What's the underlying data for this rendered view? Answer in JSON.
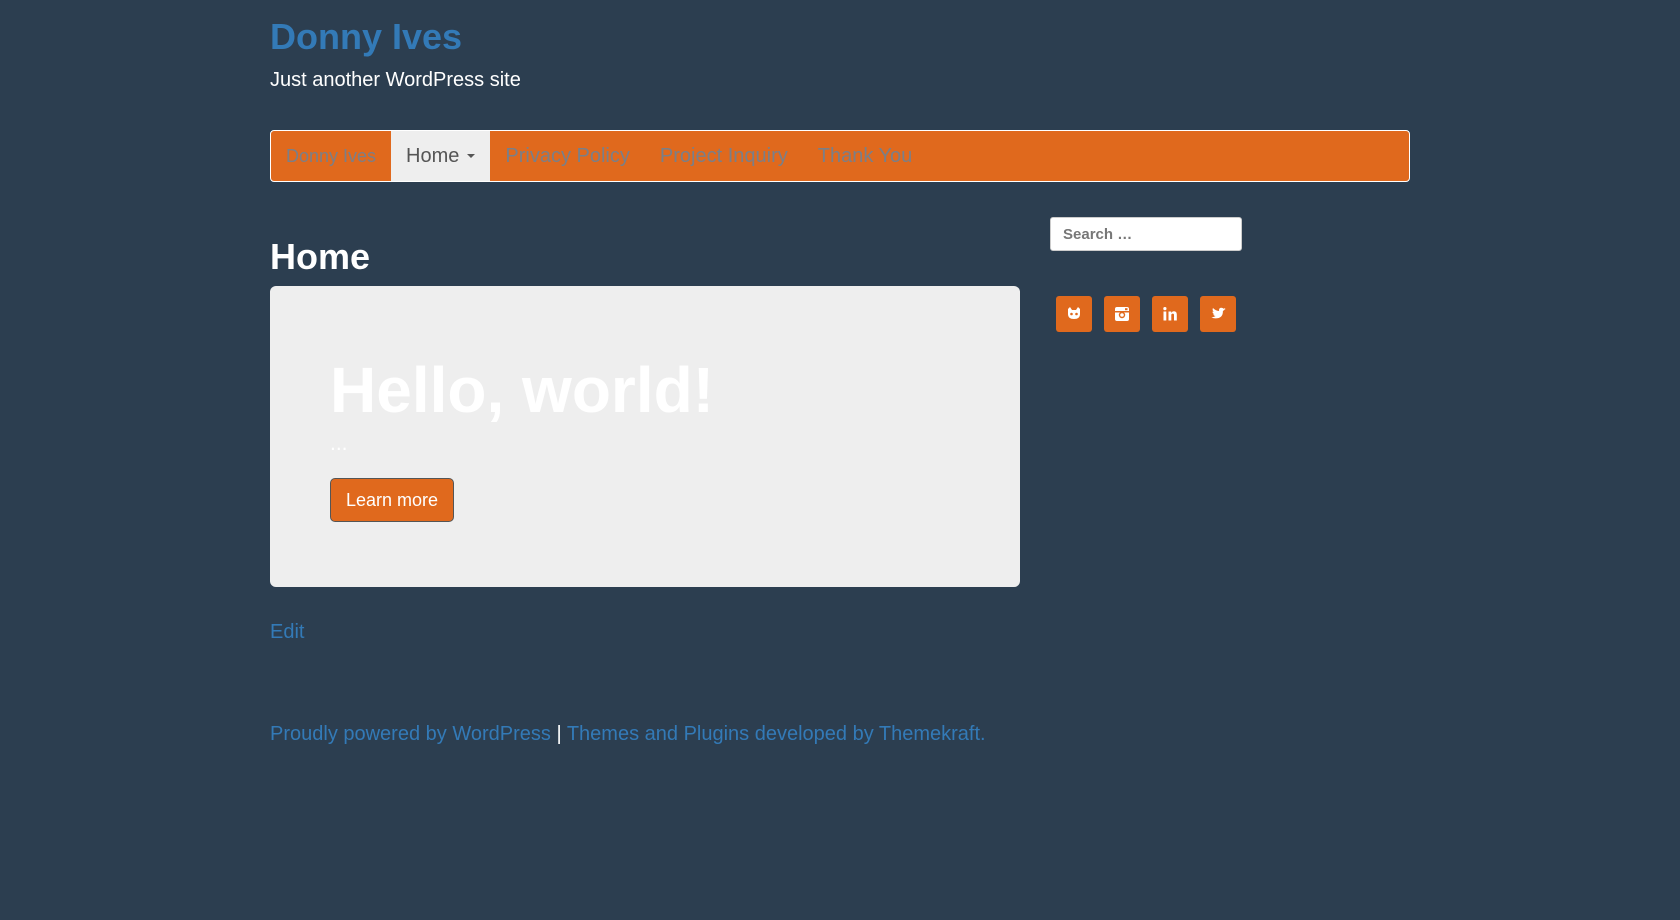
{
  "site": {
    "title": "Donny Ives",
    "description": "Just another WordPress site"
  },
  "nav": {
    "brand": "Donny Ives",
    "items": [
      {
        "label": "Home",
        "active": true,
        "has_dropdown": true
      },
      {
        "label": "Privacy Policy"
      },
      {
        "label": "Project Inquiry"
      },
      {
        "label": "Thank You"
      }
    ]
  },
  "main": {
    "page_title": "Home",
    "jumbotron": {
      "heading": "Hello, world!",
      "text": "...",
      "button_label": "Learn more"
    },
    "edit_label": "Edit"
  },
  "sidebar": {
    "search_placeholder": "Search …",
    "social": [
      {
        "icon": "github-icon"
      },
      {
        "icon": "instagram-icon"
      },
      {
        "icon": "linkedin-icon"
      },
      {
        "icon": "twitter-icon"
      }
    ]
  },
  "footer": {
    "powered_by": "Proudly powered by WordPress",
    "separator": "|",
    "credits": "Themes and Plugins developed by Themekraft."
  },
  "colors": {
    "background": "#2c3e50",
    "accent": "#e0691d",
    "link": "#337ab7",
    "jumbotron": "#eeeeee"
  }
}
